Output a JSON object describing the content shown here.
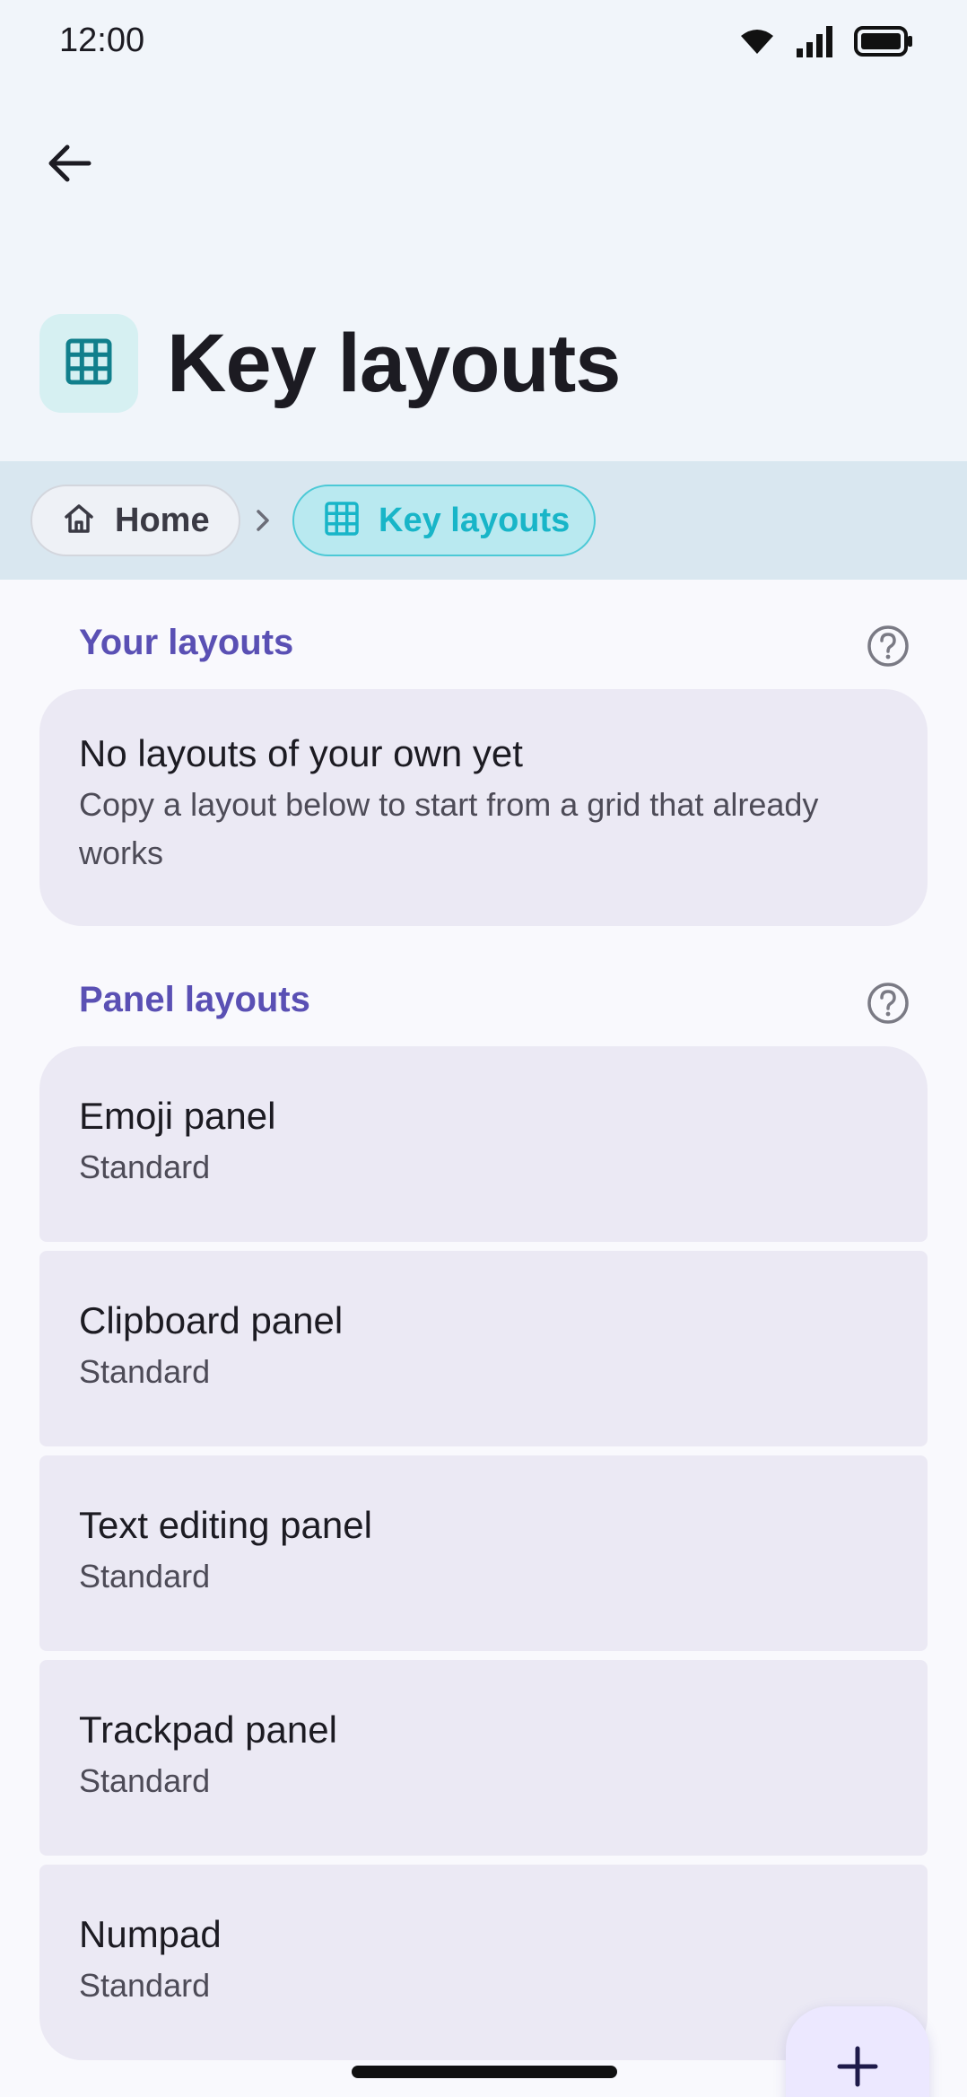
{
  "status_bar": {
    "time": "12:00",
    "icons": [
      "wifi-icon",
      "signal-icon",
      "battery-icon"
    ]
  },
  "header": {
    "back_icon": "arrow-left-icon",
    "title_icon": "grid-icon",
    "title": "Key layouts"
  },
  "breadcrumb": {
    "items": [
      {
        "label": "Home",
        "icon": "home-icon"
      },
      {
        "label": "Key layouts",
        "icon": "grid-icon"
      }
    ],
    "separator_icon": "chevron-right-icon"
  },
  "sections": {
    "your_layouts": {
      "title": "Your layouts",
      "empty_title": "No layouts of your own yet",
      "empty_text": "Copy a layout below to start from a grid that already works"
    },
    "panel_layouts": {
      "title": "Panel layouts",
      "items": [
        {
          "title": "Emoji panel",
          "subtitle": "Standard"
        },
        {
          "title": "Clipboard panel",
          "subtitle": "Standard"
        },
        {
          "title": "Text editing panel",
          "subtitle": "Standard"
        },
        {
          "title": "Trackpad panel",
          "subtitle": "Standard"
        },
        {
          "title": "Numpad",
          "subtitle": "Standard"
        }
      ]
    }
  },
  "fab": {
    "icon": "plus-icon"
  },
  "colors": {
    "accent": "#5a50b4",
    "teal": "#18b5c8",
    "card_bg": "#ebe9f4",
    "header_bg": "#f1f5fa",
    "breadcrumb_bg": "#d9e7f0"
  }
}
